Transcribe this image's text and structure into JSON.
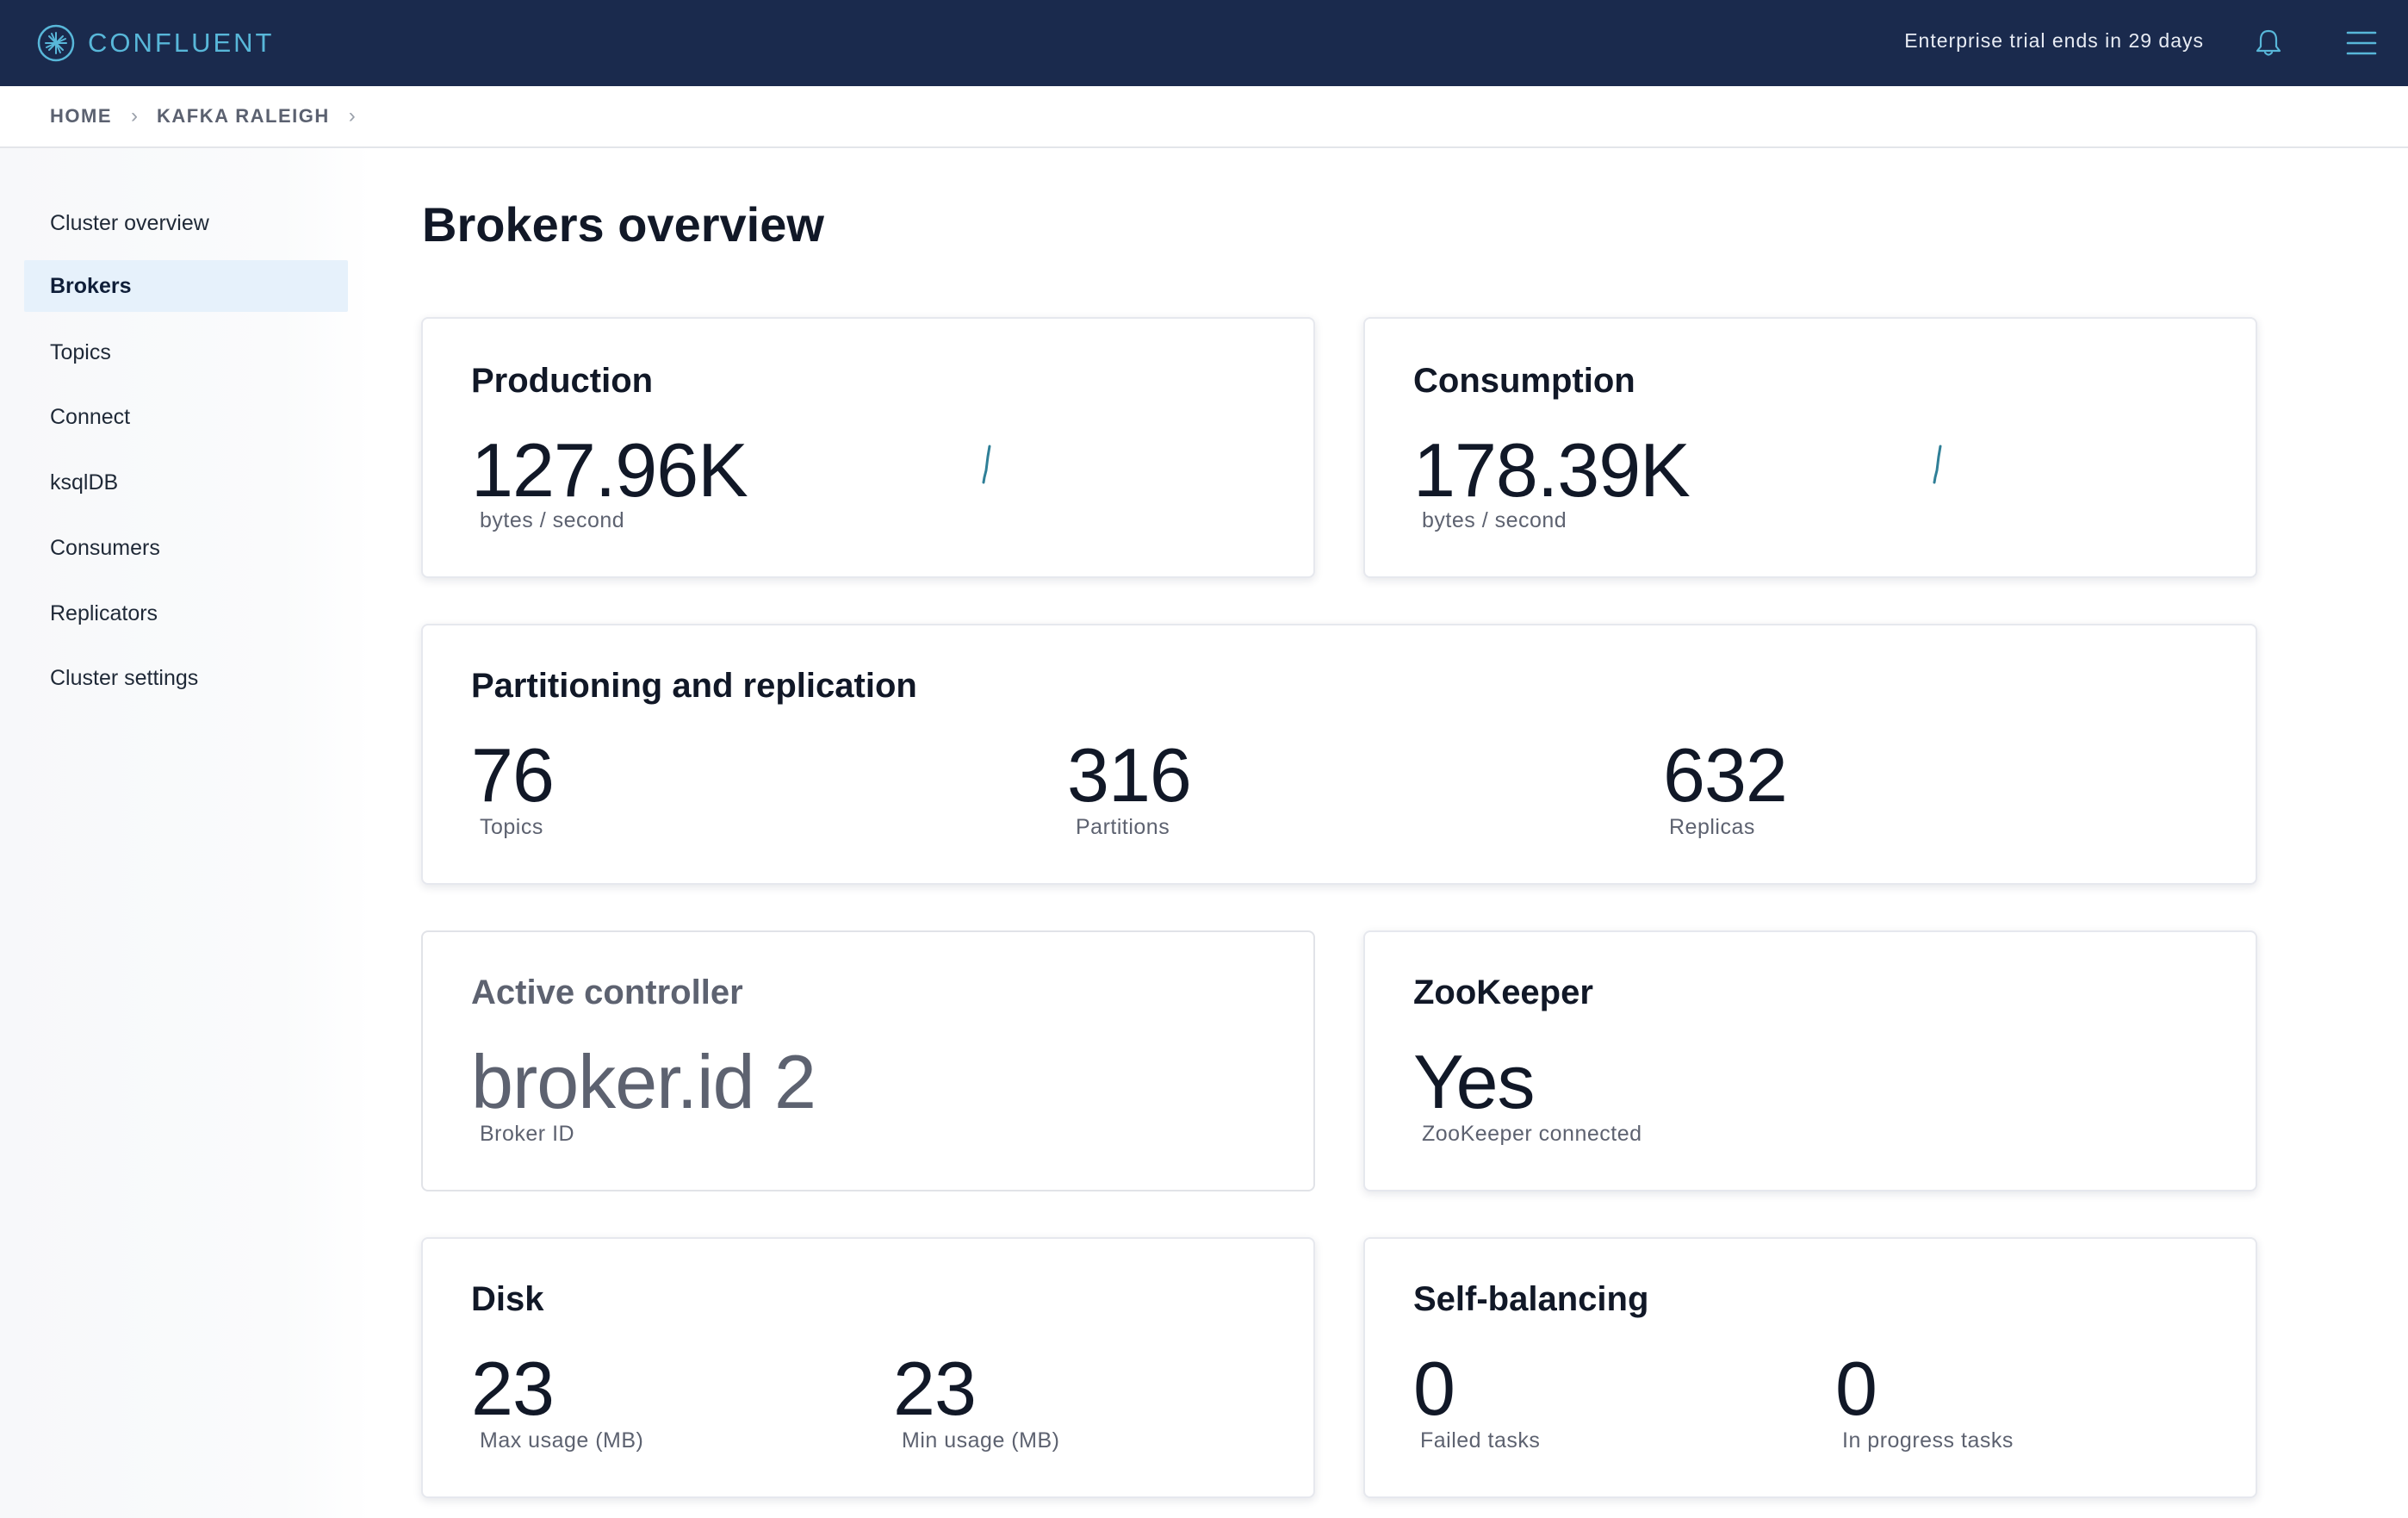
{
  "app": {
    "brand": "CONFLUENT",
    "trial_notice": "Enterprise trial ends in 29 days"
  },
  "icons": {
    "logo": "confluent-logo-icon",
    "notifications": "bell-icon",
    "menu": "hamburger-menu-icon",
    "breadcrumb_separator": "chevron-right-icon"
  },
  "colors": {
    "topbar": "#1a2a4d",
    "brand_accent": "#58b7d9",
    "active_nav_bg": "#e6f1fb",
    "sparkline": "#2f7f97"
  },
  "breadcrumb": {
    "items": [
      "HOME",
      "KAFKA RALEIGH"
    ]
  },
  "sidebar": {
    "items": [
      {
        "label": "Cluster overview",
        "active": false
      },
      {
        "label": "Brokers",
        "active": true
      },
      {
        "label": "Topics",
        "active": false
      },
      {
        "label": "Connect",
        "active": false
      },
      {
        "label": "ksqlDB",
        "active": false
      },
      {
        "label": "Consumers",
        "active": false
      },
      {
        "label": "Replicators",
        "active": false
      },
      {
        "label": "Cluster settings",
        "active": false
      }
    ]
  },
  "main": {
    "title": "Brokers overview",
    "production": {
      "title": "Production",
      "value": "127.96K",
      "unit": "bytes / second"
    },
    "consumption": {
      "title": "Consumption",
      "value": "178.39K",
      "unit": "bytes / second"
    },
    "partitioning": {
      "title": "Partitioning and replication",
      "topics": {
        "value": "76",
        "label": "Topics"
      },
      "partitions": {
        "value": "316",
        "label": "Partitions"
      },
      "replicas": {
        "value": "632",
        "label": "Replicas"
      }
    },
    "active_controller": {
      "title": "Active controller",
      "value": "broker.id 2",
      "label": "Broker ID"
    },
    "zookeeper": {
      "title": "ZooKeeper",
      "value": "Yes",
      "label": "ZooKeeper connected"
    },
    "disk": {
      "title": "Disk",
      "max": {
        "value": "23",
        "label": "Max usage (MB)"
      },
      "min": {
        "value": "23",
        "label": "Min usage (MB)"
      }
    },
    "self_balancing": {
      "title": "Self-balancing",
      "failed": {
        "value": "0",
        "label": "Failed tasks"
      },
      "in_progress": {
        "value": "0",
        "label": "In progress tasks"
      }
    }
  }
}
